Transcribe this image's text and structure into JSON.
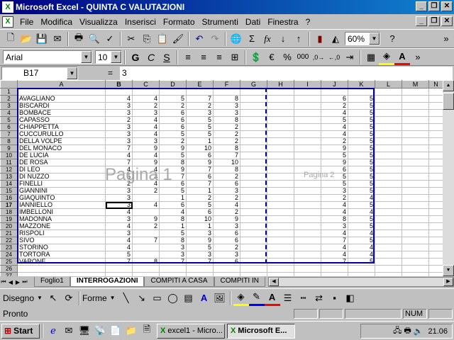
{
  "window": {
    "title": "Microsoft Excel - QUINTA C VALUTAZIONI"
  },
  "menu": [
    "File",
    "Modifica",
    "Visualizza",
    "Inserisci",
    "Formato",
    "Strumenti",
    "Dati",
    "Finestra",
    "?"
  ],
  "toolbar": {
    "zoom": "60%"
  },
  "format": {
    "font": "Arial",
    "size": "10",
    "bold": "G",
    "italic": "C",
    "underline": "S",
    "euro": "€",
    "percent": "%",
    "thousands": "000"
  },
  "formula": {
    "namebox": "B17",
    "equals": "=",
    "value": "3"
  },
  "columns": [
    "A",
    "B",
    "C",
    "D",
    "E",
    "F",
    "G",
    "H",
    "I",
    "J",
    "K",
    "L",
    "M",
    "N"
  ],
  "rows": [
    {
      "n": "1",
      "name": "",
      "v": [
        "",
        "",
        "",
        "",
        "",
        "",
        "",
        "",
        "",
        ""
      ]
    },
    {
      "n": "2",
      "name": "AVAGLIANO",
      "v": [
        "4",
        "4",
        "5",
        "7",
        "8",
        "",
        "",
        "",
        "6",
        "5"
      ]
    },
    {
      "n": "3",
      "name": "BISCARDI",
      "v": [
        "3",
        "2",
        "2",
        "2",
        "3",
        "",
        "",
        "",
        "2",
        "5"
      ]
    },
    {
      "n": "4",
      "name": "BOMBACE",
      "v": [
        "3",
        "3",
        "6",
        "3",
        "3",
        "",
        "",
        "",
        "4",
        "5"
      ]
    },
    {
      "n": "5",
      "name": "CAPASSO",
      "v": [
        "2",
        "4",
        "6",
        "5",
        "8",
        "",
        "",
        "",
        "5",
        "5"
      ]
    },
    {
      "n": "6",
      "name": "CHIAPPETTA",
      "v": [
        "3",
        "4",
        "6",
        "5",
        "2",
        "",
        "",
        "",
        "4",
        "5"
      ]
    },
    {
      "n": "7",
      "name": "CUCCURULLO",
      "v": [
        "3",
        "4",
        "5",
        "5",
        "2",
        "",
        "",
        "",
        "4",
        "5"
      ]
    },
    {
      "n": "8",
      "name": "DELLA VOLPE",
      "v": [
        "3",
        "3",
        "2",
        "1",
        "2",
        "",
        "",
        "",
        "2",
        "5"
      ]
    },
    {
      "n": "9",
      "name": "DEL MONACO",
      "v": [
        "7",
        "9",
        "9",
        "10",
        "8",
        "",
        "",
        "",
        "9",
        "5"
      ]
    },
    {
      "n": "10",
      "name": "DE LUCIA",
      "v": [
        "4",
        "4",
        "5",
        "6",
        "7",
        "",
        "",
        "",
        "5",
        "5"
      ]
    },
    {
      "n": "11",
      "name": "DE ROSA",
      "v": [
        "7",
        "9",
        "8",
        "9",
        "10",
        "",
        "",
        "",
        "9",
        "5"
      ]
    },
    {
      "n": "12",
      "name": "DI LEO",
      "v": [
        "4",
        "4",
        "9",
        "7",
        "8",
        "",
        "",
        "",
        "6",
        "5"
      ]
    },
    {
      "n": "13",
      "name": "DI NUZZO",
      "v": [
        "5",
        "3",
        "7",
        "6",
        "2",
        "",
        "",
        "",
        "5",
        "5"
      ]
    },
    {
      "n": "14",
      "name": "FINELLI",
      "v": [
        "2",
        "4",
        "6",
        "7",
        "6",
        "",
        "",
        "",
        "5",
        "5"
      ]
    },
    {
      "n": "15",
      "name": "GIANNINI",
      "v": [
        "3",
        "2",
        "5",
        "1",
        "3",
        "",
        "",
        "",
        "3",
        "5"
      ]
    },
    {
      "n": "16",
      "name": "GIAQUINTO",
      "v": [
        "3",
        "",
        "1",
        "2",
        "2",
        "",
        "",
        "",
        "2",
        "4"
      ]
    },
    {
      "n": "17",
      "name": "IANNIELLO",
      "v": [
        "3",
        "4",
        "6",
        "5",
        "4",
        "",
        "",
        "",
        "4",
        "5"
      ]
    },
    {
      "n": "18",
      "name": "IMBELLONI",
      "v": [
        "4",
        "",
        "4",
        "6",
        "2",
        "",
        "",
        "",
        "4",
        "4"
      ]
    },
    {
      "n": "19",
      "name": "MADONNA",
      "v": [
        "3",
        "9",
        "8",
        "10",
        "9",
        "",
        "",
        "",
        "8",
        "5"
      ]
    },
    {
      "n": "20",
      "name": "MAZZONE",
      "v": [
        "4",
        "2",
        "1",
        "1",
        "3",
        "",
        "",
        "",
        "3",
        "5"
      ]
    },
    {
      "n": "21",
      "name": "RISPOLI",
      "v": [
        "3",
        "",
        "5",
        "3",
        "6",
        "",
        "",
        "",
        "4",
        "4"
      ]
    },
    {
      "n": "22",
      "name": "SIVO",
      "v": [
        "4",
        "7",
        "8",
        "9",
        "6",
        "",
        "",
        "",
        "7",
        "5"
      ]
    },
    {
      "n": "23",
      "name": "STORINO",
      "v": [
        "4",
        "",
        "3",
        "5",
        "2",
        "",
        "",
        "",
        "4",
        "4"
      ]
    },
    {
      "n": "24",
      "name": "TORTORA",
      "v": [
        "5",
        "",
        "3",
        "3",
        "3",
        "",
        "",
        "",
        "4",
        "4"
      ]
    },
    {
      "n": "25",
      "name": "VARONE",
      "v": [
        "7",
        "8",
        "7",
        "7",
        "6",
        "",
        "",
        "",
        "7",
        "5"
      ]
    },
    {
      "n": "26",
      "name": "",
      "v": [
        "",
        "",
        "",
        "",
        "",
        "",
        "",
        "",
        "",
        ""
      ]
    },
    {
      "n": "27",
      "name": "",
      "v": [
        "",
        "",
        "",
        "",
        "",
        "",
        "",
        "",
        "",
        ""
      ]
    },
    {
      "n": "28",
      "name": "",
      "v": [
        "",
        "",
        "",
        "",
        "",
        "",
        "",
        "",
        "",
        ""
      ]
    }
  ],
  "watermarks": {
    "page1": "Pagina 1",
    "page2": "Pagina 2"
  },
  "sheets": [
    "Foglio1",
    "INTERROGAZIONI",
    "COMPITI A CASA",
    "COMPITI IN"
  ],
  "draw": {
    "disegno": "Disegno",
    "forme": "Forme"
  },
  "status": {
    "ready": "Pronto",
    "num": "NUM"
  },
  "taskbar": {
    "start": "Start",
    "task1": "excel1 - Micro...",
    "task2": "Microsoft E...",
    "clock": "21.06"
  },
  "colors": {
    "title_start": "#000080",
    "title_end": "#1084d0",
    "page_border": "#0000a0"
  }
}
